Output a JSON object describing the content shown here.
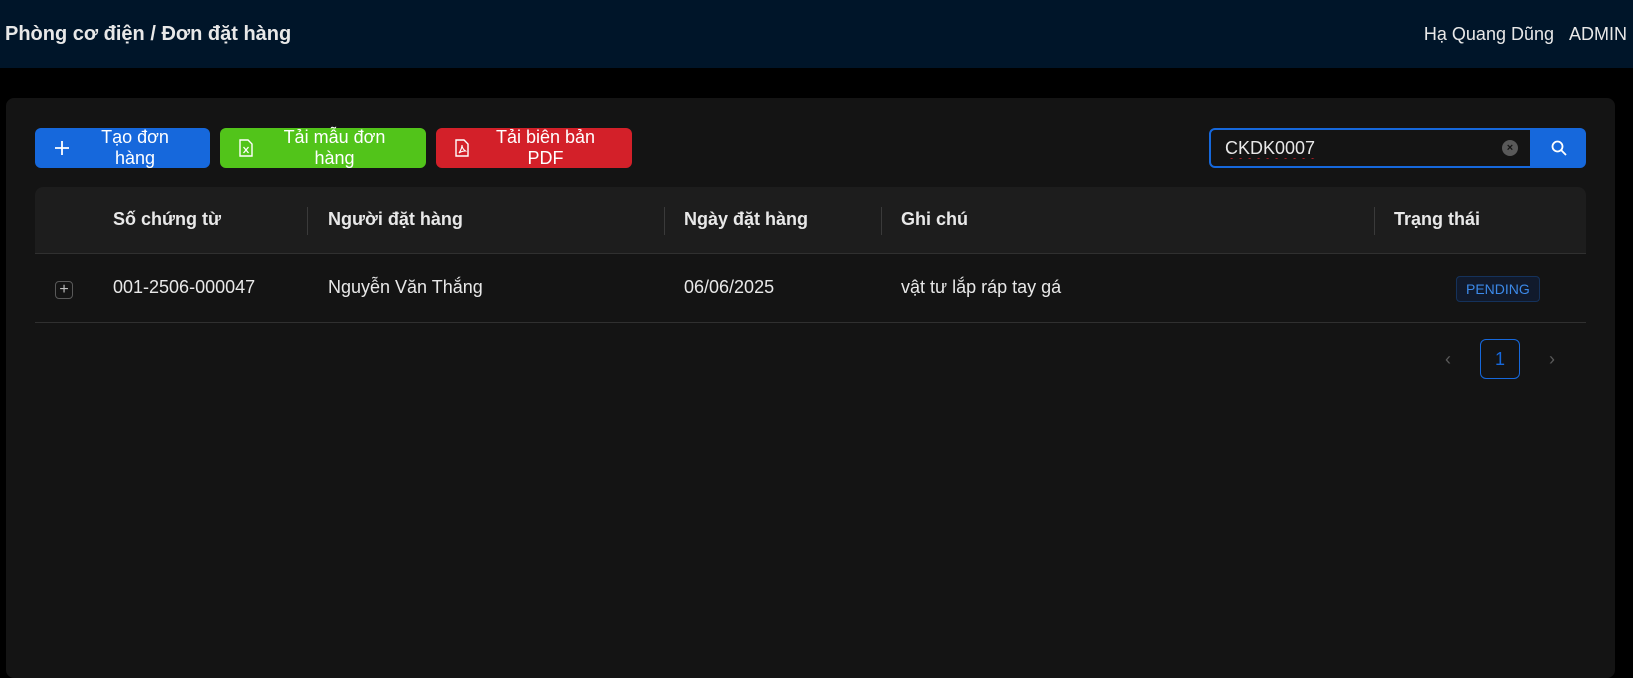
{
  "header": {
    "breadcrumb": "Phòng cơ điện / Đơn đặt hàng",
    "user_name": "Hạ Quang Dũng",
    "role": "ADMIN"
  },
  "toolbar": {
    "create_label": "Tạo đơn hàng",
    "template_label": "Tải mẫu đơn hàng",
    "pdf_label": "Tải biên bản PDF"
  },
  "search": {
    "value": "CKDK0007",
    "placeholder": ""
  },
  "table": {
    "columns": [
      "Số chứng từ",
      "Người đặt hàng",
      "Ngày đặt hàng",
      "Ghi chú",
      "Trạng thái"
    ],
    "rows": [
      {
        "doc_no": "001-2506-000047",
        "orderer": "Nguyễn Văn Thắng",
        "date": "06/06/2025",
        "note": "vật tư lắp ráp tay gá",
        "status": "PENDING"
      }
    ]
  },
  "pagination": {
    "current_page": "1"
  },
  "colors": {
    "primary": "#1668dc",
    "success": "#52c41a",
    "danger": "#d32029",
    "header_bg": "#001529"
  }
}
